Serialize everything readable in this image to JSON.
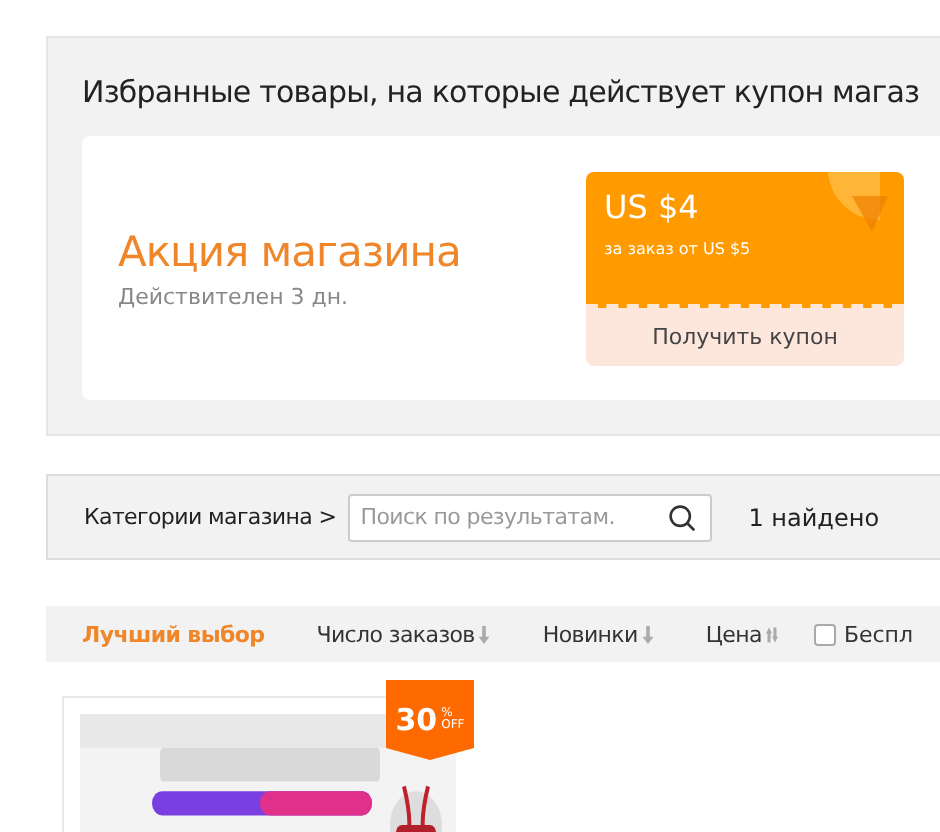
{
  "promo": {
    "title": "Избранные товары, на которые действует купон магаз",
    "store_promo": {
      "heading": "Акция магазина",
      "validity": "Действителен 3 дн."
    },
    "coupon": {
      "amount": "US $4",
      "condition": "за заказ от US $5",
      "button": "Получить купон"
    }
  },
  "search_bar": {
    "categories": "Категории магазина >",
    "placeholder": "Поиск по результатам.",
    "result_count": "1 найдено"
  },
  "sort_bar": {
    "options": [
      {
        "label": "Лучший выбор",
        "selected": true,
        "kind": "plain"
      },
      {
        "label": "Число заказов",
        "selected": false,
        "kind": "down"
      },
      {
        "label": "Новинки",
        "selected": false,
        "kind": "down"
      },
      {
        "label": "Цена",
        "selected": false,
        "kind": "updown"
      }
    ],
    "checkbox": {
      "label": "Беспл",
      "checked": false
    }
  },
  "products": [
    {
      "kind": "picture",
      "discount": {
        "number": "30",
        "percent": "%",
        "off": "OFF"
      }
    }
  ]
}
